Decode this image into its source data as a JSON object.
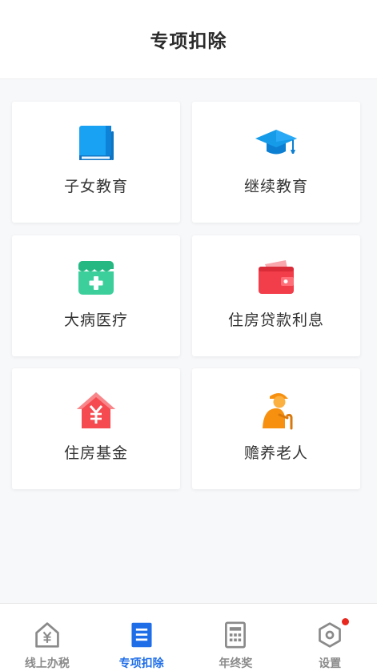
{
  "header": {
    "title": "专项扣除"
  },
  "cards": [
    {
      "label": "子女教育",
      "icon": "book-icon"
    },
    {
      "label": "继续教育",
      "icon": "graduation-cap-icon"
    },
    {
      "label": "大病医疗",
      "icon": "medical-box-icon"
    },
    {
      "label": "住房贷款利息",
      "icon": "wallet-icon"
    },
    {
      "label": "住房基金",
      "icon": "house-yuan-icon"
    },
    {
      "label": "赡养老人",
      "icon": "elderly-person-icon"
    }
  ],
  "tabbar": {
    "active_index": 1,
    "items": [
      {
        "label": "线上办税",
        "icon": "house-yuan-outline-icon"
      },
      {
        "label": "专项扣除",
        "icon": "document-icon"
      },
      {
        "label": "年终奖",
        "icon": "calculator-icon"
      },
      {
        "label": "设置",
        "icon": "settings-hexagon-icon",
        "badge": true
      }
    ]
  },
  "colors": {
    "accent": "#1f6ee8",
    "book": "#19a2f4",
    "cap": "#169be9",
    "medical": "#3ccf9b",
    "wallet": "#f23d4a",
    "house": "#f54a4f",
    "elderly": "#f7900f",
    "badge": "#e8281e"
  }
}
